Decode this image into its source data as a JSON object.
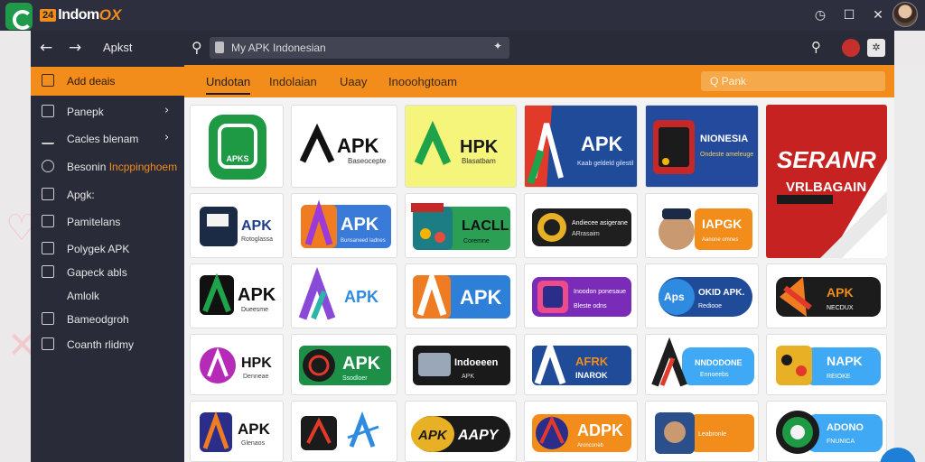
{
  "titlebar": {
    "brand_badge": "24",
    "brand_name": "Indom",
    "brand_accent": "OX",
    "icons": [
      "clock-icon",
      "maximize-icon",
      "close-icon"
    ]
  },
  "navbar": {
    "title": "Apkst",
    "address": "My APK Indonesian",
    "address_icon": "lock-icon"
  },
  "sidebar": {
    "items": [
      {
        "label": "Add deais",
        "icon": "plus-icon"
      },
      {
        "label": "Panepk",
        "icon": "window-icon"
      },
      {
        "label": "Cacles blenam",
        "icon": "download-icon"
      },
      {
        "label": "Besonin",
        "highlight": "Incppinghoem",
        "icon": "disc-icon"
      },
      {
        "label": "Apgk:",
        "icon": "puzzle-icon"
      },
      {
        "label": "Pamitelans",
        "icon": "grid-icon"
      },
      {
        "label": "Polygek APK",
        "icon": "window-icon"
      },
      {
        "label": "Gapeck abls",
        "icon": "card-icon"
      },
      {
        "label": "Amlolk",
        "icon": ""
      },
      {
        "label": "Bameodgroh",
        "icon": "card-icon"
      },
      {
        "label": "Coanth rlidmy",
        "icon": "list-icon"
      }
    ]
  },
  "tabs": [
    {
      "label": "Undotan",
      "active": true
    },
    {
      "label": "Indolaian",
      "active": false
    },
    {
      "label": "Uaay",
      "active": false
    },
    {
      "label": "Inooohgtoam",
      "active": false
    }
  ],
  "tab_search": {
    "placeholder": "Q Pank"
  },
  "tiles": [
    {
      "text": "APKS"
    },
    {
      "text": "APK",
      "sub": "Baseocepte"
    },
    {
      "text": "HPK",
      "sub": "Blasatbam"
    },
    {
      "text": "APK",
      "sub": "Kaab geldeld gilestil"
    },
    {
      "text": "NIONESIA",
      "sub": "Ondeste ameleuge"
    },
    {
      "text": "SERANR",
      "sub": "VRLBAGAIN"
    },
    {
      "text": "APK",
      "sub": "Rotoglassa"
    },
    {
      "text": "APK",
      "sub": "Bunsaneed ladnes"
    },
    {
      "text": "LACLL",
      "sub": "Coremne"
    },
    {
      "text": "Andiecee asigerane",
      "sub": "ARrasaim"
    },
    {
      "text": "IAPGK",
      "sub": "Aanone omnes"
    },
    {
      "text": "APK",
      "sub": "Dueesme"
    },
    {
      "text": "APK"
    },
    {
      "text": "APK"
    },
    {
      "text": "Inoodon ponesaue",
      "sub": "Bleste odns"
    },
    {
      "text": "OKID APK.",
      "sub": "Rediooe"
    },
    {
      "text": "APK",
      "sub": "NECDUX"
    },
    {
      "text": "HPK",
      "sub": "Denneae"
    },
    {
      "text": "APK",
      "sub": "Ssodloer"
    },
    {
      "text": "Indoeeen",
      "sub": "APK"
    },
    {
      "text": "AFRK",
      "sub": "INAROK"
    },
    {
      "text": "NNDODONE",
      "sub": "Ennoeebs"
    },
    {
      "text": "NAPK",
      "sub": "REIOKE"
    },
    {
      "text": "APK",
      "sub": "Glenaos"
    },
    {
      "text": "APK",
      "sub": "AAPY"
    },
    {
      "text": "ADPK",
      "sub": "Aronconeb"
    },
    {
      "text": "Leabronle"
    },
    {
      "text": "ADONO",
      "sub": "FNUNICA"
    }
  ]
}
